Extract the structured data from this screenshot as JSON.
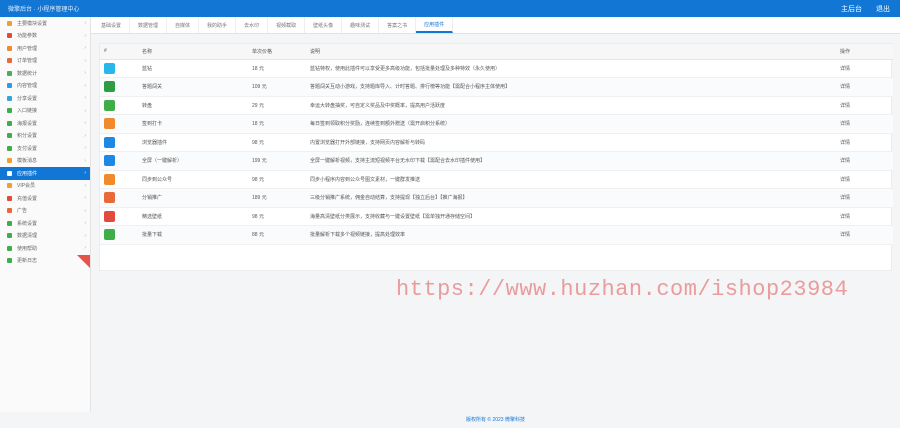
{
  "header": {
    "brand": "微擎后台 · 小程序管理中心",
    "actions": [
      "主后台",
      "退出"
    ]
  },
  "sidebar": {
    "items": [
      {
        "label": "主要模块设置",
        "color": "#f0a030"
      },
      {
        "label": "功能参数",
        "color": "#e24a3b"
      },
      {
        "label": "用户管理",
        "color": "#f08a2c"
      },
      {
        "label": "订单管理",
        "color": "#e8693a"
      },
      {
        "label": "数据统计",
        "color": "#4caf50"
      },
      {
        "label": "内容管理",
        "color": "#2e9be6"
      },
      {
        "label": "分享设置",
        "color": "#36a3d9"
      },
      {
        "label": "入口链接",
        "color": "#3fae49"
      },
      {
        "label": "海报设置",
        "color": "#3fae49"
      },
      {
        "label": "积分设置",
        "color": "#3fae49"
      },
      {
        "label": "支付设置",
        "color": "#3fae49"
      },
      {
        "label": "模板消息",
        "color": "#f0a030"
      },
      {
        "label": "应用插件",
        "color": "#ffffff",
        "active": true
      },
      {
        "label": "VIP会员",
        "color": "#f0a030"
      },
      {
        "label": "充值设置",
        "color": "#e24a3b"
      },
      {
        "label": "广告",
        "color": "#e8693a"
      },
      {
        "label": "系统设置",
        "color": "#3fae49"
      },
      {
        "label": "数据清理",
        "color": "#3fae49"
      },
      {
        "label": "使用帮助",
        "color": "#3fae49"
      },
      {
        "label": "更新日志",
        "color": "#3fae49"
      }
    ]
  },
  "tabs": [
    "基础设置",
    "数据管理",
    "自媒体",
    "我的助手",
    "去水印",
    "视频截取",
    "壁纸头像",
    "趣味测试",
    "答案之书",
    "应用插件"
  ],
  "table": {
    "headers": [
      "#",
      "名称",
      "单次价格",
      "说明",
      "操作"
    ],
    "rows": [
      {
        "icon_color": "#29b6e8",
        "name": "蓝钻",
        "price": "18 元",
        "desc": "蓝钻特权，使用此插件可以享受更多高级功能，包括批量处理及多种特效（永久使用）",
        "action": "详情"
      },
      {
        "icon_color": "#2e9d41",
        "name": "答题闯关",
        "price": "109 元",
        "desc": "答题闯关互动小游戏，支持题库导入、计时答题、排行榜等功能【需配合小程序主体使用】",
        "action": "详情"
      },
      {
        "icon_color": "#3fae49",
        "name": "转盘",
        "price": "29 元",
        "desc": "幸运大转盘抽奖，可自定义奖品及中奖概率，提高用户活跃度",
        "action": "详情"
      },
      {
        "icon_color": "#f08a2c",
        "name": "签到打卡",
        "price": "18 元",
        "desc": "每日签到领取积分奖励，连续签到额外赠送（需开启积分系统）",
        "action": "详情"
      },
      {
        "icon_color": "#1e88e5",
        "name": "浏览器插件",
        "price": "98 元",
        "desc": "内置浏览器打开外部链接，支持网页内容解析与转码",
        "action": "详情"
      },
      {
        "icon_color": "#1e88e5",
        "name": "全屏（一键解析）",
        "price": "199 元",
        "desc": "全屏一键解析视频，支持主流短视频平台无水印下载【需配合去水印插件使用】",
        "action": "详情"
      },
      {
        "icon_color": "#f08a2c",
        "name": "同步到公众号",
        "price": "98 元",
        "desc": "同步小程序内容到公众号图文素材，一键群发推送",
        "action": "详情"
      },
      {
        "icon_color": "#e8693a",
        "name": "分销推广",
        "price": "189 元",
        "desc": "三级分销推广系统，佣金自动结算，支持提现【独立后台】【推广海报】",
        "action": "详情"
      },
      {
        "icon_color": "#e24a3b",
        "name": "精选壁纸",
        "price": "98 元",
        "desc": "海量高清壁纸分类展示，支持收藏与一键设置壁纸【需单独开通存储空间】",
        "action": "详情"
      },
      {
        "icon_color": "#3fae49",
        "name": "批量下载",
        "price": "88 元",
        "desc": "批量解析下载多个视频链接，提高处理效率",
        "action": "详情"
      }
    ]
  },
  "watermark": "https://www.huzhan.com/ishop23984",
  "footer": "版权所有 © 2023 微擎科技"
}
